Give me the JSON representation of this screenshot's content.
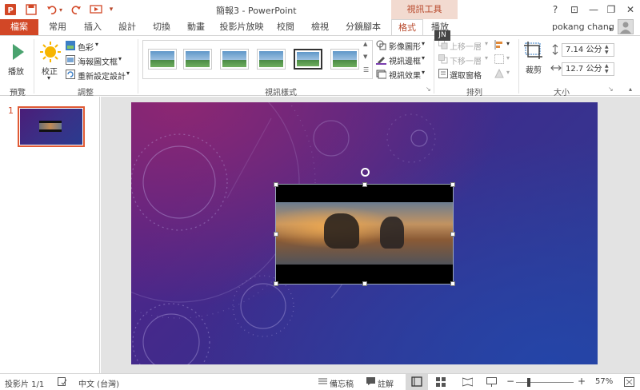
{
  "title": "簡報3 - PowerPoint",
  "context_tab_group": "視訊工具",
  "quick_access": [
    {
      "name": "powerpoint-logo-icon",
      "glyph": "P"
    },
    {
      "name": "save-icon",
      "glyph": "🖫"
    },
    {
      "name": "undo-icon",
      "glyph": "↶"
    },
    {
      "name": "redo-icon",
      "glyph": "↻"
    },
    {
      "name": "start-from-beginning-icon",
      "glyph": "⊡"
    },
    {
      "name": "customize-icon",
      "glyph": "▾"
    }
  ],
  "window_controls": [
    "?",
    "⊡",
    "—",
    "❐",
    "✕"
  ],
  "tabs": {
    "file": "檔案",
    "home": "常用",
    "insert": "插入",
    "design": "設計",
    "transitions": "切換",
    "animations": "動畫",
    "slideshow": "投影片放映",
    "review": "校閱",
    "view": "檢視",
    "storyboard": "分鏡腳本",
    "format": "格式",
    "playback": "播放"
  },
  "key_tip": "JN",
  "user_name": "pokang chang",
  "ribbon": {
    "play": "播放",
    "preview_group": "預覽",
    "corrections": "校正",
    "color": "色彩",
    "poster_frame": "海報圖文框",
    "reset_design": "重新設定設計",
    "adjust_group": "調整",
    "video_styles_group": "視訊樣式",
    "video_shape": "影像圖形",
    "video_border": "視訊邊框",
    "video_effects": "視訊效果",
    "bring_forward": "上移一層",
    "send_backward": "下移一層",
    "selection_pane": "選取窗格",
    "arrange_group": "排列",
    "crop": "裁剪",
    "height": "7.14 公分",
    "width": "12.7 公分",
    "size_group": "大小"
  },
  "slide_panel": {
    "slide_number": "1"
  },
  "status": {
    "slide_info": "投影片 1/1",
    "language": "中文 (台灣)",
    "notes": "備忘稿",
    "comments": "註解",
    "zoom_minus": "−",
    "zoom_plus": "+",
    "zoom_percent": "57%"
  },
  "colors": {
    "accent": "#d24726",
    "context_tab_bg": "#f2dad0"
  }
}
